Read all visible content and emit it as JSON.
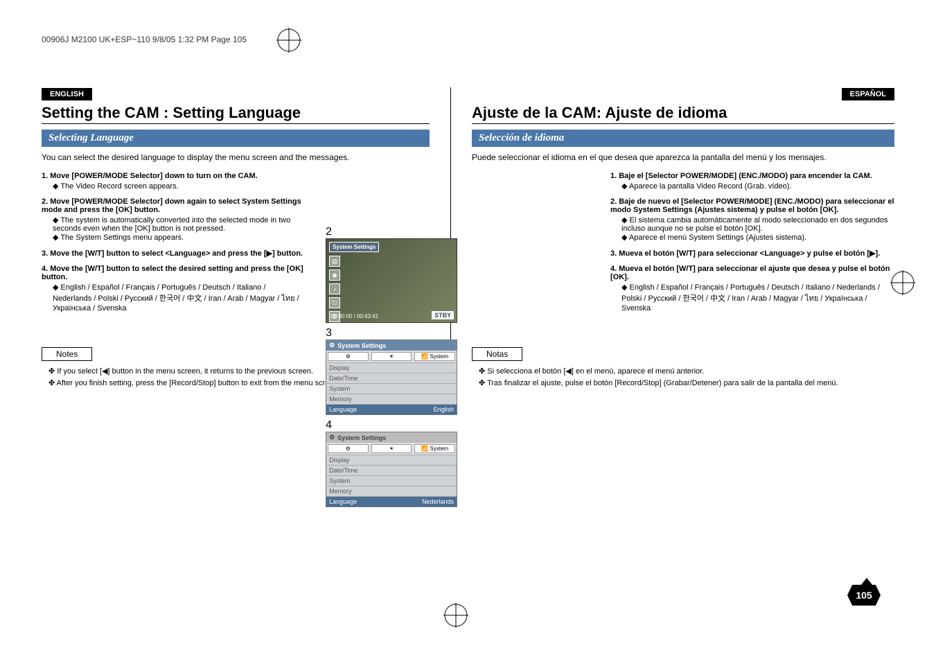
{
  "header": "00906J M2100 UK+ESP~110  9/8/05 1:32 PM  Page 105",
  "left": {
    "badge": "ENGLISH",
    "title": "Setting the CAM : Setting Language",
    "section": "Selecting Language",
    "intro": "You can select the desired language to display the menu screen and the messages.",
    "steps": [
      {
        "t": "1.  Move [POWER/MODE Selector] down to turn on the CAM.",
        "s": [
          "◆  The Video Record screen appears."
        ]
      },
      {
        "t": "2.  Move [POWER/MODE Selector] down again to select System Settings mode and press the [OK] button.",
        "s": [
          "◆  The system is automatically converted into the selected mode in two seconds even when the [OK] button is not pressed.",
          "◆  The System Settings menu appears."
        ]
      },
      {
        "t": "3.  Move the [W/T] button to select <Language> and press the [▶] button.",
        "s": []
      },
      {
        "t": "4.  Move the [W/T] button to select the desired setting and press the [OK] button.",
        "s": [
          "◆  English / Español / Français / Português / Deutsch / Italiano / Nederlands / Polski / Русский / 한국어 / 中文 / Iran / Arab / Magyar / ไทย / Українська / Svenska"
        ]
      }
    ],
    "notes_label": "Notes",
    "notes": [
      "✤  If you select [◀] button in the menu screen, it returns to the previous screen.",
      "✤  After you finish setting, press the [Record/Stop] button to exit from the menu screen."
    ]
  },
  "right": {
    "badge": "ESPAÑOL",
    "title": "Ajuste de la CAM: Ajuste de idioma",
    "section": "Selección de idioma",
    "intro": "Puede seleccionar el idioma en el que desea que aparezca la pantalla del menú y los mensajes.",
    "steps": [
      {
        "t": "1.  Baje el [Selector POWER/MODE] (ENC./MODO) para encender la CAM.",
        "s": [
          "◆  Aparece la pantalla Video Record (Grab. vídeo)."
        ]
      },
      {
        "t": "2.  Baje de nuevo el [Selector POWER/MODE] (ENC./MODO) para seleccionar el modo System Settings (Ajustes sistema) y pulse el botón [OK].",
        "s": [
          "◆  El sistema cambia automáticamente al modo seleccionado en dos segundos incluso aunque no se pulse el botón [OK].",
          "◆  Aparece el menú System Settings (Ajustes sistema)."
        ]
      },
      {
        "t": "3.  Mueva el botón [W/T] para seleccionar <Language> y pulse el botón [▶].",
        "s": []
      },
      {
        "t": "4.  Mueva el botón [W/T] para seleccionar el ajuste que desea y pulse el botón [OK].",
        "s": [
          "◆  English / Español / Français / Português / Deutsch / Italiano / Nederlands / Polski / Русский / 한국어 / 中文 / Iran / Arab / Magyar / ไทย / Українська / Svenska"
        ]
      }
    ],
    "notes_label": "Notas",
    "notes": [
      "✤  Si selecciona el botón [◀] en el menú, aparece el menú anterior.",
      "✤  Tras finalizar el ajuste, pulse el botón [Record/Stop] (Grabar/Detener) para salir de la pantalla del menú."
    ]
  },
  "center_screens": {
    "s2": {
      "num": "2",
      "title": "System Settings",
      "stby": "STBY",
      "time": "00:00:00 / 00:43:41"
    },
    "s3": {
      "num": "3",
      "title": "System Settings",
      "rows": [
        "Display",
        "Date/Time",
        "System",
        "Memory"
      ],
      "sel_label": "Language",
      "sel_value": "English",
      "icons": [
        "⚙",
        "☀",
        "📶 System"
      ]
    },
    "s4": {
      "num": "4",
      "title": "System Settings",
      "rows": [
        "Display",
        "Date/Time",
        "System",
        "Memory"
      ],
      "sel_label": "Language",
      "sel_value": "Nederlands",
      "icons": [
        "⚙",
        "☀",
        "📶 System"
      ]
    }
  },
  "page_number": "105"
}
